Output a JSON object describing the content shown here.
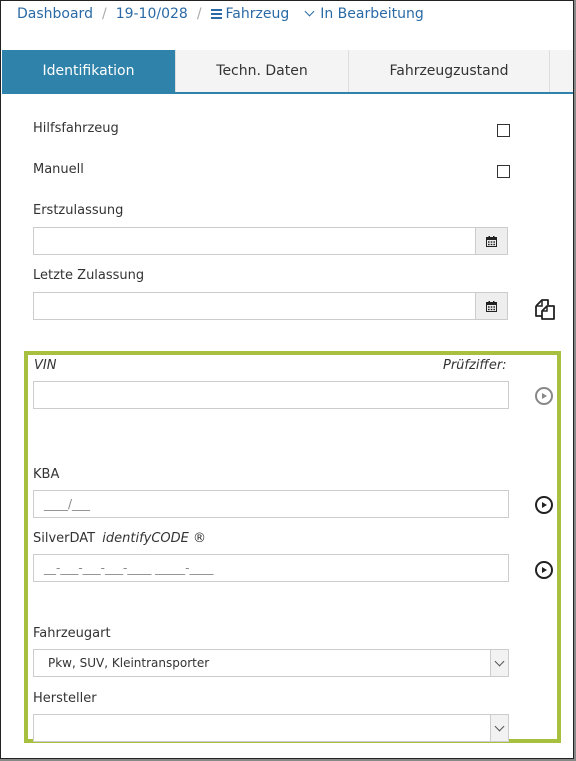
{
  "breadcrumb": {
    "dashboard": "Dashboard",
    "case_number": "19-10/028",
    "vehicle": "Fahrzeug",
    "status": "In Bearbeitung"
  },
  "tabs": [
    {
      "label": "Identifikation",
      "active": true
    },
    {
      "label": "Techn. Daten",
      "active": false
    },
    {
      "label": "Fahrzeugzustand",
      "active": false
    }
  ],
  "form": {
    "hilfsfahrzeug_label": "Hilfsfahrzeug",
    "manuell_label": "Manuell",
    "erstzulassung_label": "Erstzulassung",
    "letzte_zulassung_label": "Letzte Zulassung",
    "vin_label": "VIN",
    "pruefziffer_label": "Prüfziffer:",
    "kba_label": "KBA",
    "kba_placeholder": "____/___",
    "silverdat_label": "SilverDAT",
    "silverdat_italic": "identifyCODE ®",
    "silverdat_placeholder": "__-___-___-___-____ _____-____",
    "fahrzeugart_label": "Fahrzeugart",
    "fahrzeugart_value": "Pkw, SUV, Kleintransporter",
    "hersteller_label": "Hersteller",
    "hersteller_value": ""
  },
  "colors": {
    "accent": "#2f82a9",
    "link": "#2a6aa6",
    "highlight": "#a8c040"
  },
  "icons": {
    "hamburger": "menu-icon",
    "calendar": "calendar-icon",
    "copy": "copy-icon",
    "play": "play-circle-icon"
  }
}
